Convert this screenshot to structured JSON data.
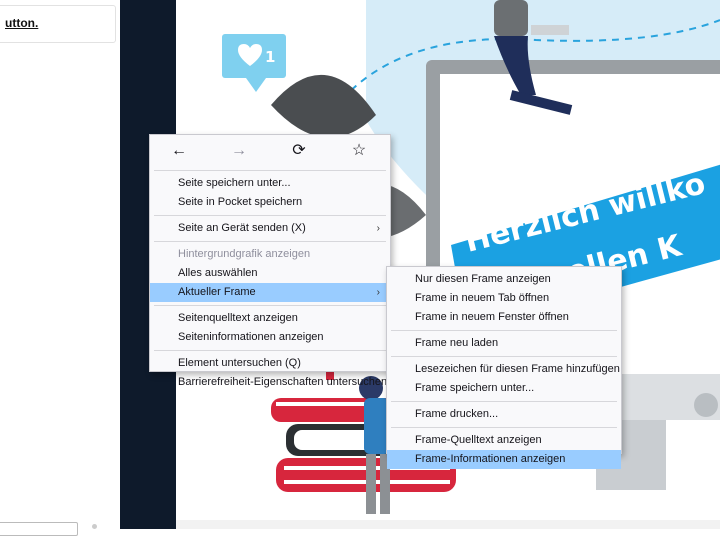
{
  "page_hint": {
    "text": "utton."
  },
  "context_menu": {
    "nav": {
      "back_icon": "←",
      "forward_icon": "→",
      "reload_icon": "⟳",
      "bookmark_icon": "☆"
    },
    "items": [
      {
        "label": "Seite speichern unter...",
        "disabled": false
      },
      {
        "label": "Seite in Pocket speichern",
        "disabled": false
      },
      {
        "label": "Seite an Gerät senden (X)",
        "disabled": false,
        "submenu": true
      },
      {
        "label": "Hintergrundgrafik anzeigen",
        "disabled": true
      },
      {
        "label": "Alles auswählen",
        "disabled": false
      },
      {
        "label": "Aktueller Frame",
        "disabled": false,
        "submenu": true,
        "highlight": true
      },
      {
        "label": "Seitenquelltext anzeigen",
        "disabled": false
      },
      {
        "label": "Seiteninformationen anzeigen",
        "disabled": false
      },
      {
        "label": "Element untersuchen (Q)",
        "disabled": false
      },
      {
        "label": "Barrierefreiheit-Eigenschaften untersuchen",
        "disabled": false
      }
    ]
  },
  "frame_submenu": {
    "items": [
      {
        "label": "Nur diesen Frame anzeigen"
      },
      {
        "label": "Frame in neuem Tab öffnen"
      },
      {
        "label": "Frame in neuem Fenster öffnen"
      },
      {
        "label": "Frame neu laden"
      },
      {
        "label": "Lesezeichen für diesen Frame hinzufügen"
      },
      {
        "label": "Frame speichern unter..."
      },
      {
        "label": "Frame drucken..."
      },
      {
        "label": "Frame-Quelltext anzeigen"
      },
      {
        "label": "Frame-Informationen anzeigen",
        "highlight": true
      }
    ]
  },
  "illustration": {
    "like_badge_count": "1",
    "banner_line1": "Herzlich willko",
    "banner_line2": "rtuellen K"
  },
  "colors": {
    "banner_blue": "#1ba1e2",
    "nav_dark": "#0e1a2b",
    "menu_highlight": "#99ccff",
    "book_red": "#d7263d"
  }
}
